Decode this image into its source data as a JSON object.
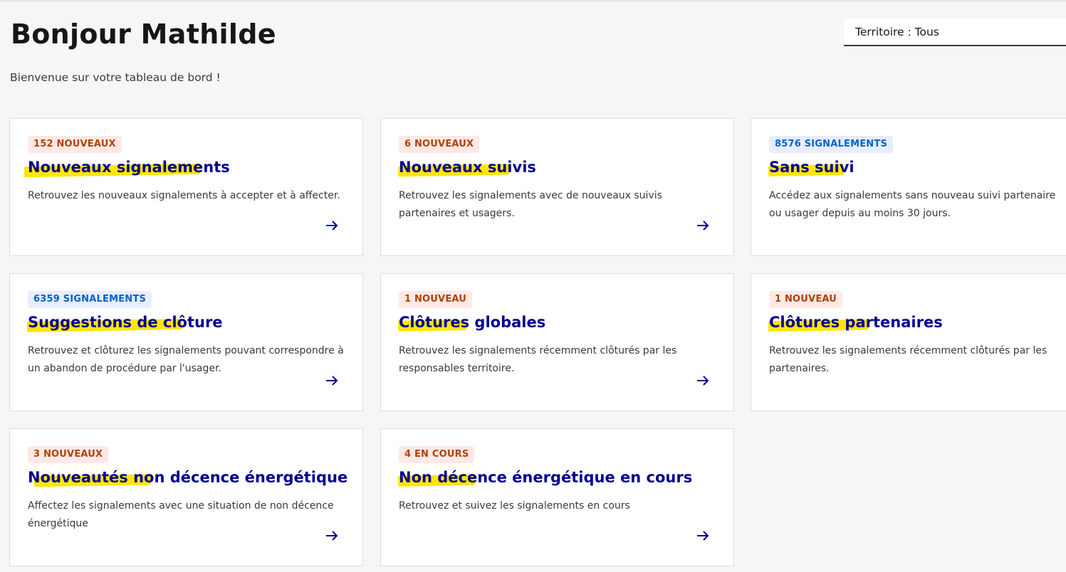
{
  "header": {
    "greeting": "Bonjour Mathilde",
    "welcome": "Bienvenue sur votre tableau de bord !",
    "territory_select": "Territoire : Tous"
  },
  "colors": {
    "accent": "#000091",
    "badge_warning_bg": "#fee9e6",
    "badge_warning_text": "#b34000",
    "badge_info_bg": "#e8edff",
    "badge_info_text": "#0063cb",
    "highlight": "#ffe600"
  },
  "icons": {
    "card_link": "arrow-right-icon"
  },
  "cards": [
    {
      "badge": "152 NOUVEAUX",
      "badge_type": "warning",
      "title": "Nouveaux signalements",
      "description": "Retrouvez les nouveaux signalements à accepter et à affecter.",
      "has_link": true
    },
    {
      "badge": "6 NOUVEAUX",
      "badge_type": "warning",
      "title": "Nouveaux suivis",
      "description": "Retrouvez les signalements avec de nouveaux suivis partenaires et usagers.",
      "has_link": true
    },
    {
      "badge": "8576 SIGNALEMENTS",
      "badge_type": "info",
      "title": "Sans suivi",
      "description": "Accédez aux signalements sans nouveau suivi partenaire ou usager depuis au moins 30 jours.",
      "has_link": false
    },
    {
      "badge": "6359 SIGNALEMENTS",
      "badge_type": "info",
      "title": "Suggestions de clôture",
      "description": "Retrouvez et clôturez les signalements pouvant correspondre à un abandon de procédure par l'usager.",
      "has_link": true
    },
    {
      "badge": "1 NOUVEAU",
      "badge_type": "warning",
      "title": "Clôtures globales",
      "description": "Retrouvez les signalements récemment clôturés par les responsables territoire.",
      "has_link": true
    },
    {
      "badge": "1 NOUVEAU",
      "badge_type": "warning",
      "title": "Clôtures partenaires",
      "description": "Retrouvez les signalements récemment clôturés par les partenaires.",
      "has_link": false
    },
    {
      "badge": "3 NOUVEAUX",
      "badge_type": "warning",
      "title": "Nouveautés non décence énergétique",
      "description": "Affectez les signalements avec une situation de non décence énergétique",
      "has_link": true
    },
    {
      "badge": "4 EN COURS",
      "badge_type": "warning",
      "title": "Non décence énergétique en cours",
      "description": "Retrouvez et suivez les signalements en cours",
      "has_link": true
    }
  ]
}
